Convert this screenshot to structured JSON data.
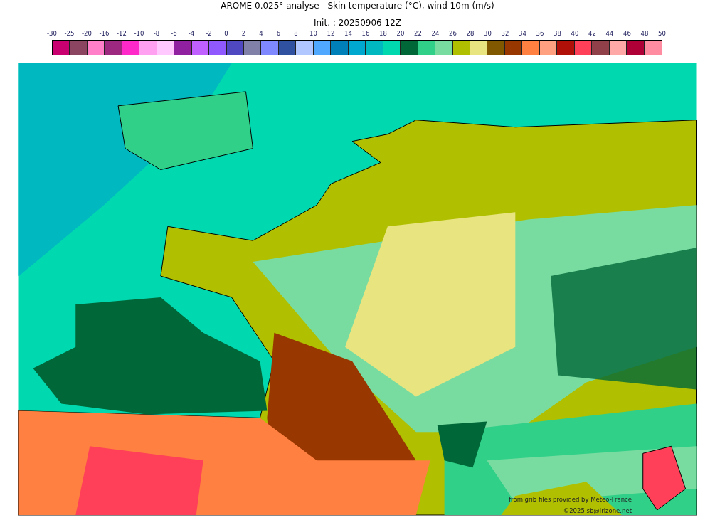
{
  "title": "AROME 0.025° analyse - Skin temperature (°C), wind 10m (m/s)",
  "subtitle": "Init. : 20250906 12Z",
  "colorbar": {
    "labels": [
      "-30",
      "-25",
      "-20",
      "-16",
      "-12",
      "-10",
      "-8",
      "-6",
      "-4",
      "-2",
      "0",
      "2",
      "4",
      "6",
      "8",
      "10",
      "12",
      "14",
      "16",
      "18",
      "20",
      "22",
      "24",
      "26",
      "28",
      "30",
      "32",
      "34",
      "36",
      "38",
      "40",
      "42",
      "44",
      "46",
      "48",
      "50"
    ],
    "swatches": [
      {
        "color": "#c90070"
      },
      {
        "color": "#8b4560"
      },
      {
        "color": "#ff80c8"
      },
      {
        "color": "#9c2880"
      },
      {
        "color": "#ff28c8"
      },
      {
        "color": "#ffa0f0"
      },
      {
        "color": "#ffc8ff"
      },
      {
        "color": "#9020a0"
      },
      {
        "color": "#c060ff"
      },
      {
        "color": "#9058ff"
      },
      {
        "color": "#5048c0"
      },
      {
        "color": "#8080a8"
      },
      {
        "color": "#8088ff"
      },
      {
        "color": "#3050a0"
      },
      {
        "color": "#b0c8ff"
      },
      {
        "color": "#50a8ff"
      },
      {
        "color": "#0080b8"
      },
      {
        "color": "#00a8d0"
      },
      {
        "color": "#00b8c0"
      },
      {
        "color": "#00d8b0"
      },
      {
        "color": "#006838"
      },
      {
        "color": "#30d088"
      },
      {
        "color": "#78dca0"
      },
      {
        "color": "#b0c000"
      },
      {
        "color": "#e8e480"
      },
      {
        "color": "#805800"
      },
      {
        "color": "#983800"
      },
      {
        "color": "#ff8040"
      },
      {
        "color": "#ffa080"
      },
      {
        "color": "#b01008"
      },
      {
        "color": "#ff4058"
      },
      {
        "color": "#904048"
      },
      {
        "color": "#ffa8a8"
      },
      {
        "color": "#b00038"
      },
      {
        "color": "#ff8ca0"
      }
    ]
  },
  "map": {
    "credit": "from grib files provided by Meteo-France",
    "copyright": "©2025 sb@irizone.net"
  }
}
